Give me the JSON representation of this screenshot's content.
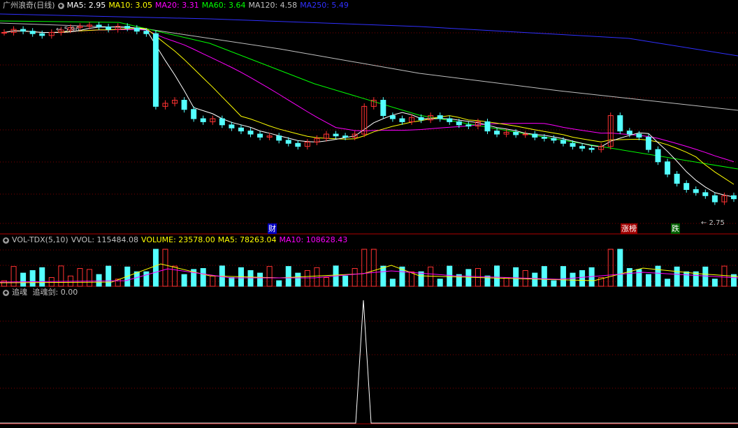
{
  "main": {
    "title": "广州浪奇(日线)",
    "indicators": [
      {
        "label": "MA5: 2.95",
        "color": "#ffffff"
      },
      {
        "label": "MA10: 3.05",
        "color": "#ffff00"
      },
      {
        "label": "MA20: 3.31",
        "color": "#ff00ff"
      },
      {
        "label": "MA60: 3.64",
        "color": "#00ff00"
      },
      {
        "label": "MA120: 4.58",
        "color": "#c0c0c0"
      },
      {
        "label": "MA250: 5.49",
        "color": "#3030ff"
      }
    ],
    "high_marker": "5.96",
    "low_marker": "2.75",
    "events": [
      {
        "label": "财",
        "bg": "#0000c0",
        "color": "#ffffff"
      },
      {
        "label": "涨榜",
        "bg": "#a00000",
        "color": "#ffffff"
      },
      {
        "label": "跌",
        "bg": "#006000",
        "color": "#ffffff"
      }
    ]
  },
  "volume_panel": {
    "name": "VOL-TDX(5,10)",
    "vvol": "VVOL: 115484.08",
    "volume": "VOLUME: 23578.00",
    "ma5": "MA5: 78263.04",
    "ma10": "MA10: 108628.43"
  },
  "indicator_panel": {
    "name": "追魂",
    "label": "追魂剑: 0.00"
  },
  "colors": {
    "up": "#ff3232",
    "down": "#54ffff",
    "ma5": "#ffffff",
    "ma10": "#ffff00",
    "ma20": "#ff00ff",
    "ma60": "#00ff00",
    "ma120": "#c0c0c0",
    "ma250": "#3030ff",
    "grid": "#800000"
  }
}
